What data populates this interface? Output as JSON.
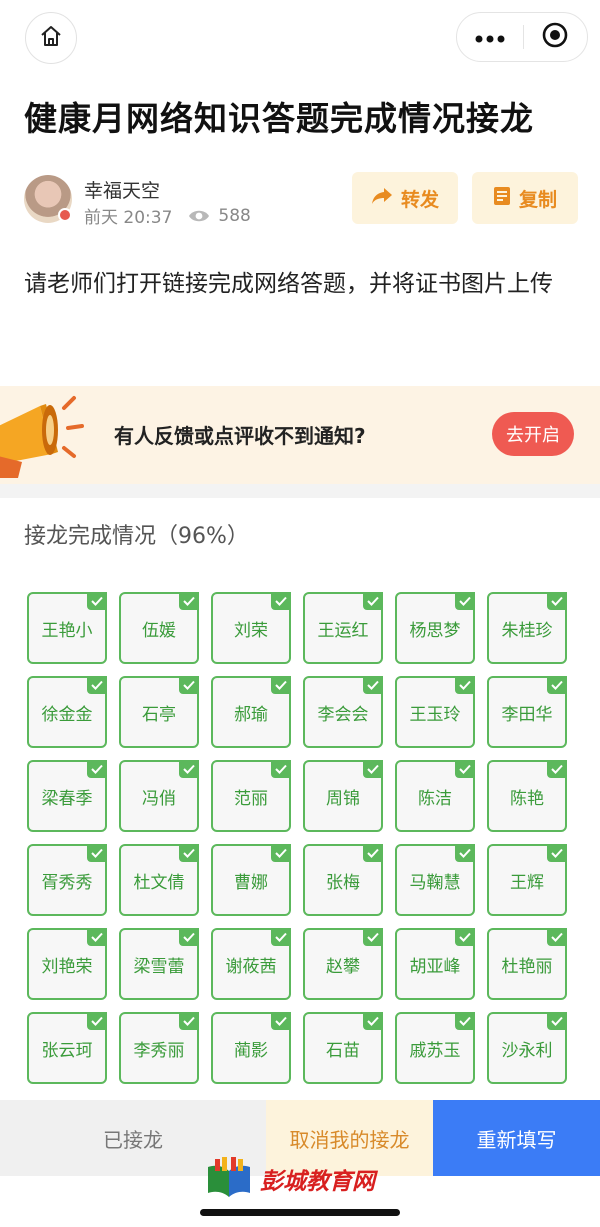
{
  "header": {
    "title": "健康月网络知识答题完成情况接龙"
  },
  "author": {
    "name": "幸福天空",
    "time": "前天 20:37",
    "views": "588"
  },
  "actions": {
    "forward_label": "转发",
    "copy_label": "复制"
  },
  "description": "请老师们打开链接完成网络答题，并将证书图片上传",
  "notice": {
    "text": "有人反馈或点评收不到通知?",
    "button_label": "去开启"
  },
  "progress": {
    "title": "接龙完成情况（96%）",
    "percent": 96
  },
  "participants": [
    "王艳小",
    "伍媛",
    "刘荣",
    "王运红",
    "杨思梦",
    "朱桂珍",
    "徐金金",
    "石亭",
    "郝瑜",
    "李会会",
    "王玉玲",
    "李田华",
    "梁春季",
    "冯俏",
    "范丽",
    "周锦",
    "陈洁",
    "陈艳",
    "胥秀秀",
    "杜文倩",
    "曹娜",
    "张梅",
    "马鞠慧",
    "王辉",
    "刘艳荣",
    "梁雪蕾",
    "谢莜茜",
    "赵攀",
    "胡亚峰",
    "杜艳丽",
    "张云珂",
    "李秀丽",
    "蔺影",
    "石苗",
    "戚苏玉",
    "沙永利"
  ],
  "bottom": {
    "done_label": "已接龙",
    "cancel_label": "取消我的接龙",
    "refill_label": "重新填写"
  },
  "watermark": {
    "text": "彭城教育网"
  },
  "colors": {
    "accent_orange": "#e88b20",
    "check_green": "#5cb85c",
    "notice_red": "#ef5a52",
    "refill_blue": "#3b7cf6"
  }
}
